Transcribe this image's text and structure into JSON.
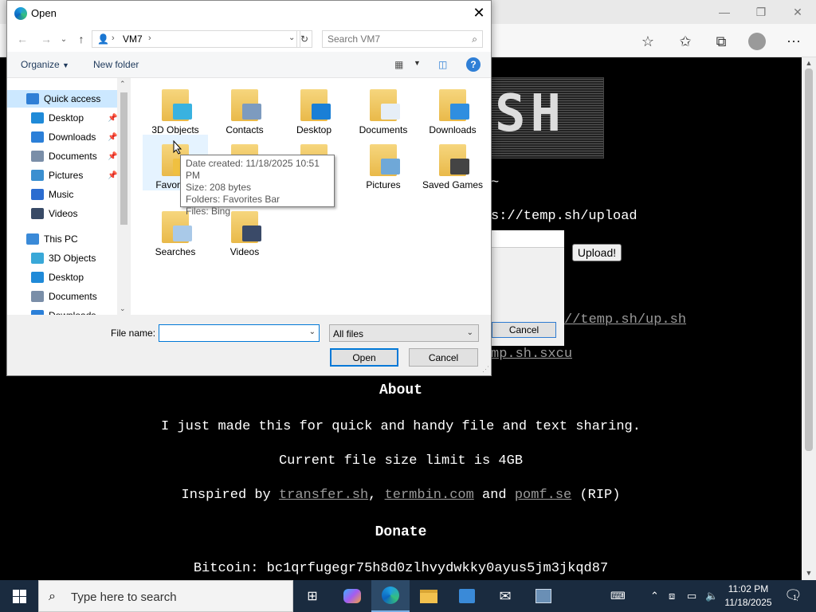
{
  "browser": {
    "page": {
      "prompt_suffix": "~",
      "upload_url": "s://temp.sh/upload",
      "upload_button": "Upload!",
      "inner_cancel": "Cancel",
      "script_link": "//temp.sh/up.sh",
      "sxcu_link": "mp.sh.sxcu",
      "about_heading": "About",
      "about_text": "I just made this for quick and handy file and text sharing.",
      "limit_text": "Current file size limit is 4GB",
      "inspired_prefix": "Inspired by",
      "inspired_links": [
        "transfer.sh",
        "termbin.com",
        "pomf.se"
      ],
      "inspired_and": "and",
      "inspired_suffix": "(RIP)",
      "donate_heading": "Donate",
      "bitcoin_label": "Bitcoin:",
      "bitcoin_address": "bc1qrfugegr75h8d0zlhvydwkky0ayus5jm3jkqd87"
    }
  },
  "dialog": {
    "title": "Open",
    "address": {
      "root": "VM7"
    },
    "search_placeholder": "Search VM7",
    "cmd": {
      "organize": "Organize",
      "new_folder": "New folder"
    },
    "nav_items": [
      {
        "label": "Quick access",
        "icon": "star-icon",
        "color": "#2f7fd6",
        "pinned": false,
        "selected": true
      },
      {
        "label": "Desktop",
        "icon": "desktop-icon",
        "color": "#1f8ad8",
        "pinned": true
      },
      {
        "label": "Downloads",
        "icon": "download-icon",
        "color": "#2b7fd8",
        "pinned": true
      },
      {
        "label": "Documents",
        "icon": "documents-icon",
        "color": "#7a8ea8",
        "pinned": true
      },
      {
        "label": "Pictures",
        "icon": "pictures-icon",
        "color": "#3b8fd0",
        "pinned": true
      },
      {
        "label": "Music",
        "icon": "music-icon",
        "color": "#2b6cd0",
        "pinned": false
      },
      {
        "label": "Videos",
        "icon": "videos-icon",
        "color": "#384a66",
        "pinned": false
      },
      {
        "label": "This PC",
        "icon": "computer-icon",
        "color": "#3a8ad8",
        "pinned": false
      },
      {
        "label": "3D Objects",
        "icon": "cube-icon",
        "color": "#39a8d8",
        "pinned": false
      },
      {
        "label": "Desktop",
        "icon": "desktop-icon",
        "color": "#1f8ad8",
        "pinned": false
      },
      {
        "label": "Documents",
        "icon": "documents-icon",
        "color": "#7a8ea8",
        "pinned": false
      },
      {
        "label": "Downloads",
        "icon": "download-icon",
        "color": "#2b7fd8",
        "pinned": false
      }
    ],
    "files": [
      {
        "label": "3D Objects",
        "icon": "cube-icon",
        "overlay": "#39b2e0"
      },
      {
        "label": "Contacts",
        "icon": "contacts-icon",
        "overlay": "#7d9bbf"
      },
      {
        "label": "Desktop",
        "icon": "desktop-icon",
        "overlay": "#1a7fd6"
      },
      {
        "label": "Documents",
        "icon": "documents-icon",
        "overlay": "#e6eef7"
      },
      {
        "label": "Downloads",
        "icon": "download-icon",
        "overlay": "#2f8ee0"
      },
      {
        "label": "Favorites",
        "icon": "star-icon",
        "overlay": "#f0c040"
      },
      {
        "label": "Links",
        "icon": "link-icon",
        "overlay": "#3d7fd0"
      },
      {
        "label": "Music",
        "icon": "music-icon",
        "overlay": "#2b6cd0"
      },
      {
        "label": "Pictures",
        "icon": "pictures-icon",
        "overlay": "#6fa8d8"
      },
      {
        "label": "Saved Games",
        "icon": "chess-icon",
        "overlay": "#444444"
      },
      {
        "label": "Searches",
        "icon": "magnifier-icon",
        "overlay": "#a9c9e8"
      },
      {
        "label": "Videos",
        "icon": "film-icon",
        "overlay": "#3a4a68"
      }
    ],
    "tooltip": {
      "date_created": "Date created: 11/18/2025 10:51 PM",
      "size": "Size: 208 bytes",
      "folders": "Folders: Favorites Bar",
      "files": "Files: Bing"
    },
    "file_name_label": "File name:",
    "file_name_value": "",
    "filter": "All files",
    "open_button": "Open",
    "cancel_button": "Cancel"
  },
  "taskbar": {
    "search_placeholder": "Type here to search",
    "time": "11:02 PM",
    "date": "11/18/2025",
    "notification_count": "1"
  }
}
